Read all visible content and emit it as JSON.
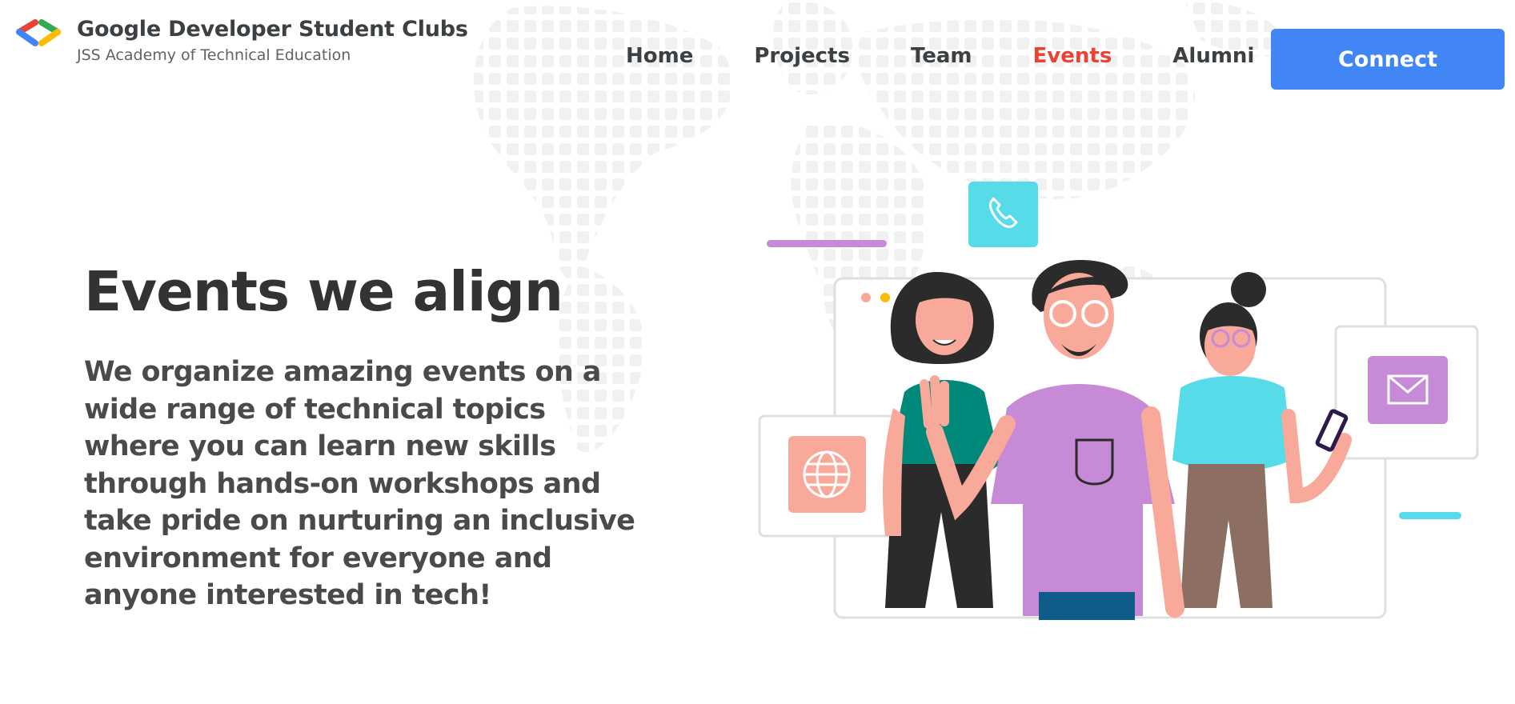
{
  "brand": {
    "title": "Google Developer Student Clubs",
    "subtitle": "JSS Academy of Technical Education",
    "logo_icon": "gdsc-brackets-logo-icon"
  },
  "nav": {
    "items": [
      {
        "label": "Home",
        "active": false
      },
      {
        "label": "Projects",
        "active": false
      },
      {
        "label": "Team",
        "active": false
      },
      {
        "label": "Events",
        "active": true
      },
      {
        "label": "Alumni",
        "active": false
      }
    ],
    "connect_label": "Connect"
  },
  "hero": {
    "title": "Events we align",
    "description": "We organize amazing events on a wide range of technical topics where you can learn new skills through hands-on workshops and take pride on nurturing an inclusive environment for everyone and anyone interested in tech!"
  },
  "illustration": {
    "icons": [
      "phone-icon",
      "mail-icon",
      "globe-icon"
    ]
  },
  "colors": {
    "accent_blue": "#4285f4",
    "active_red": "#ea4335",
    "logo_green": "#34a853",
    "logo_yellow": "#fbbc04",
    "text_dark": "#3c4043",
    "phone_tile": "#56dbe8",
    "mail_tile": "#c68ad6",
    "globe_tile": "#f8a99a"
  }
}
